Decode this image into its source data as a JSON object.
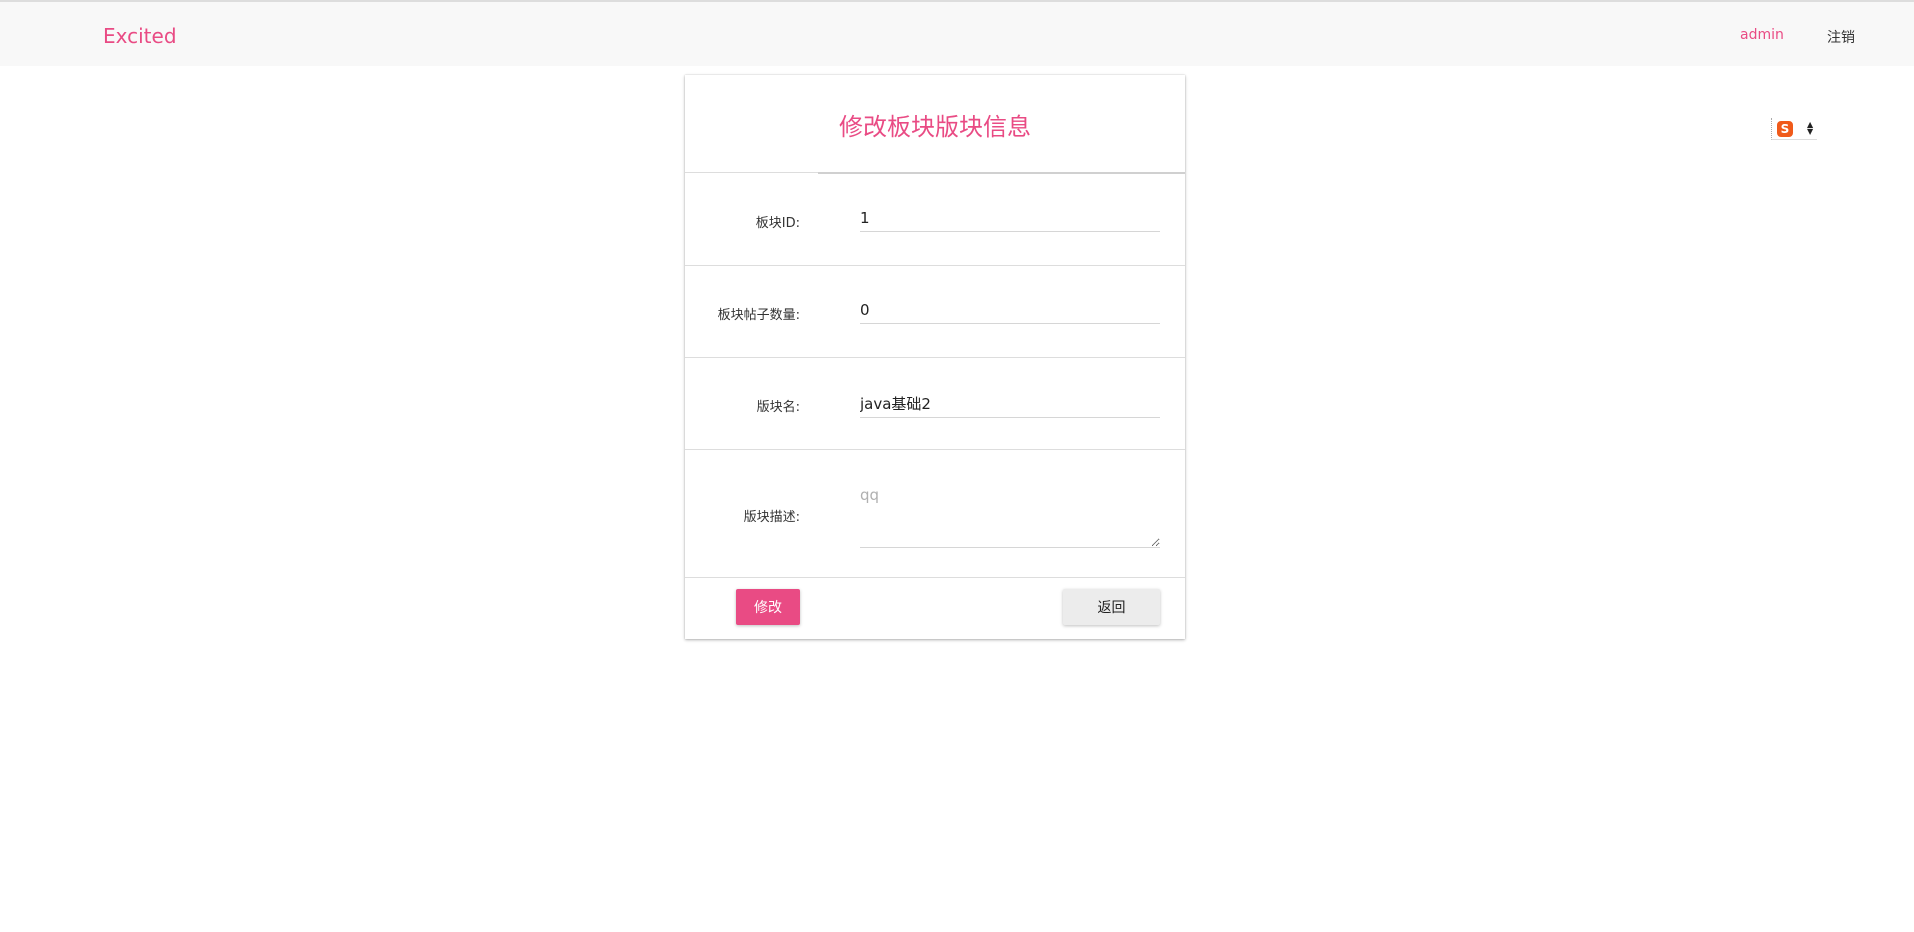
{
  "navbar": {
    "brand": "Excited",
    "user": "admin",
    "logout": "注销"
  },
  "form": {
    "title": "修改板块版块信息",
    "fields": [
      {
        "label": "板块ID:",
        "value": "1"
      },
      {
        "label": "板块帖子数量:",
        "value": "0"
      },
      {
        "label": "版块名:",
        "value": "java基础2"
      },
      {
        "label": "版块描述:",
        "placeholder": "qq"
      }
    ],
    "submit_label": "修改",
    "back_label": "返回"
  },
  "ime": {
    "logo_char": "S",
    "icon": "sogou-ime-icon"
  },
  "colors": {
    "accent": "#e94b84",
    "navbar_bg": "#f8f8f8"
  }
}
